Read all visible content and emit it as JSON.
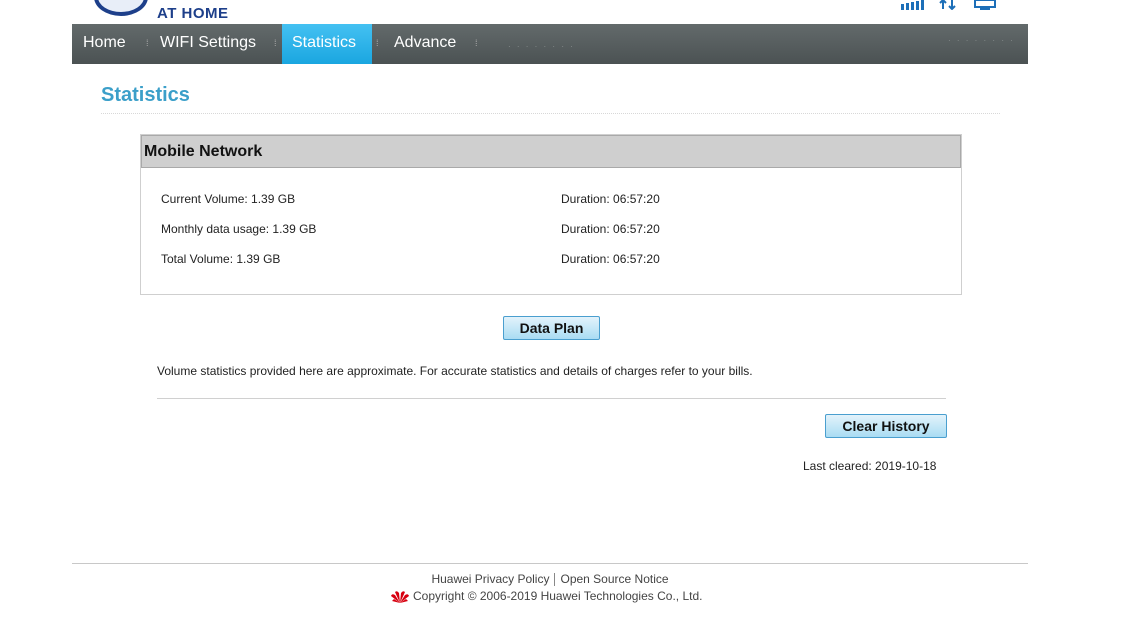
{
  "brand": {
    "tagline": "AT HOME"
  },
  "nav": {
    "items": [
      {
        "label": "Home",
        "active": false
      },
      {
        "label": "WIFI Settings",
        "active": false
      },
      {
        "label": "Statistics",
        "active": true
      },
      {
        "label": "Advance",
        "active": false
      }
    ]
  },
  "page": {
    "title": "Statistics"
  },
  "panel": {
    "title": "Mobile Network",
    "rows": [
      {
        "label": "Current Volume: 1.39 GB",
        "duration": "Duration: 06:57:20"
      },
      {
        "label": "Monthly data usage: 1.39 GB",
        "duration": "Duration: 06:57:20"
      },
      {
        "label": "Total Volume: 1.39 GB",
        "duration": "Duration: 06:57:20"
      }
    ]
  },
  "buttons": {
    "data_plan": "Data Plan",
    "clear_history": "Clear History"
  },
  "note": "Volume statistics provided here are approximate. For accurate statistics and details of charges refer to your bills.",
  "last_cleared": "Last cleared: 2019-10-18",
  "footer": {
    "privacy": "Huawei Privacy Policy",
    "open_source": "Open Source Notice",
    "copyright": "Copyright © 2006-2019 Huawei Technologies Co., Ltd."
  },
  "colors": {
    "accent": "#3b9fc9",
    "nav_active": "#1aa6e0",
    "nav_bg": "#5a6162",
    "brand": "#1d3f8a",
    "huawei_red": "#d7000f"
  },
  "icons": [
    "signal-icon",
    "data-transfer-icon",
    "computer-icon",
    "huawei-logo-icon"
  ]
}
